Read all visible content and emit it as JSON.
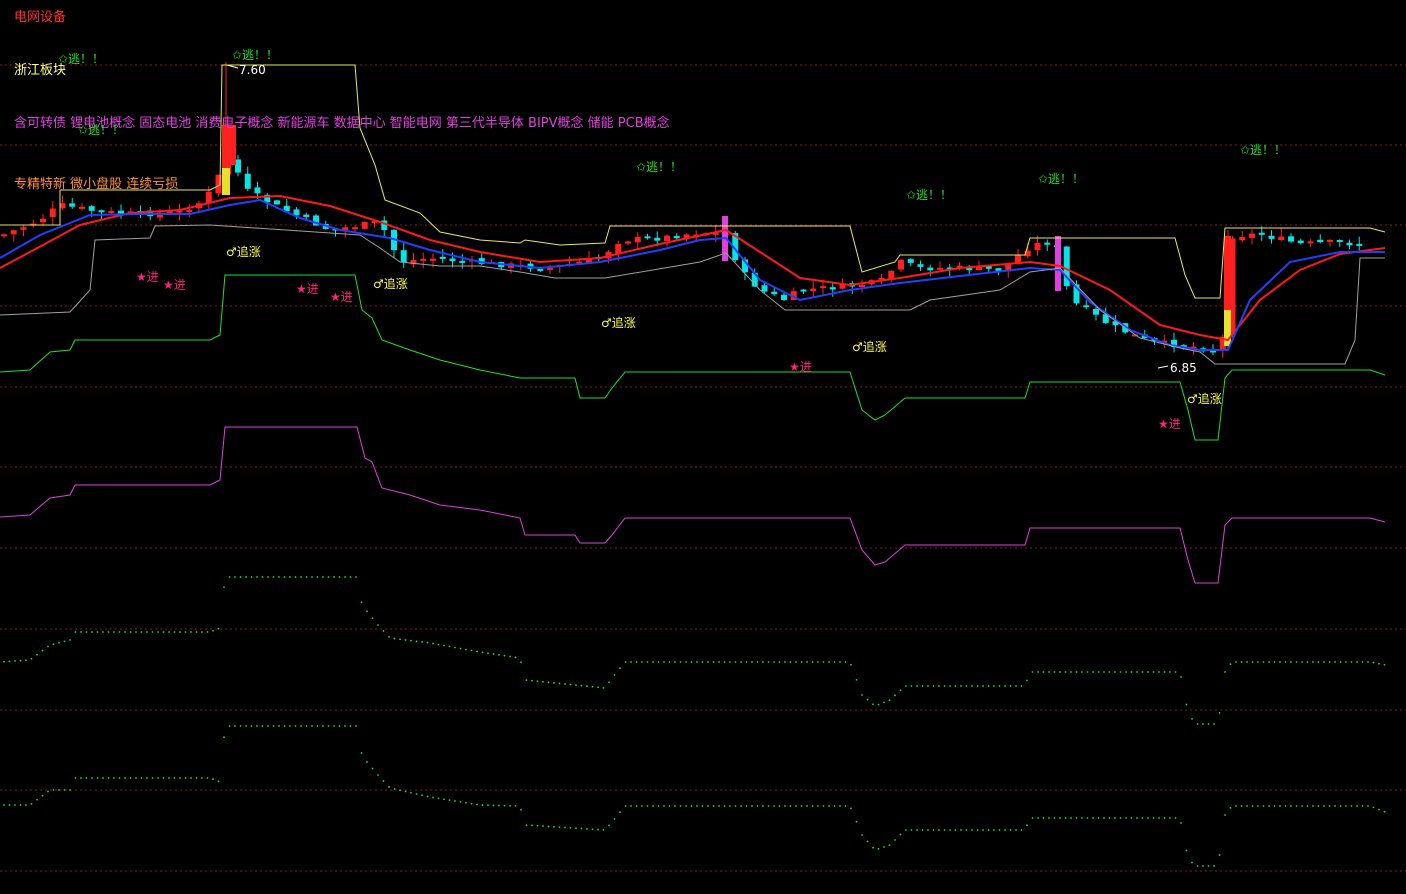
{
  "header": {
    "stock_sector": "电网设备",
    "region": "浙江板块",
    "concepts": "含可转债 锂电池概念 固态电池 消费电子概念 新能源车 数据中心 智能电网 第三代半导体 BIPV概念 储能 PCB概念",
    "tags": "专精特新 微小盘股 连续亏损"
  },
  "colors": {
    "background": "#000000",
    "grid": "#8b1a1a",
    "sector_text": "#ff3030",
    "region_text": "#ffff80",
    "concepts_text": "#e040e0",
    "tags_text": "#ff9030",
    "up_candle": "#ff2020",
    "down_candle": "#00e5e5",
    "ma_fast": "#2040ff",
    "ma_slow": "#ff1a1a",
    "band_yellow": "#e8e860",
    "band_gray": "#a0a0a0",
    "band_green": "#20e020",
    "band_magenta": "#e040e0",
    "dots": "#20e020",
    "escape_signal": "#20e020",
    "chase_signal": "#ffff40",
    "enter_signal": "#ff2080"
  },
  "chart_data": {
    "type": "candlestick",
    "bars": 140,
    "annotations": [
      {
        "text": "7.60",
        "bar": 22,
        "kind": "high"
      },
      {
        "text": "6.85",
        "bar": 115,
        "kind": "low"
      }
    ],
    "signals": [
      {
        "text": "✩逃！！",
        "kind": "escape",
        "bar": 6
      },
      {
        "text": "✩逃！！",
        "kind": "escape",
        "bar": 23
      },
      {
        "text": "✩逃！！",
        "kind": "escape",
        "bar": 8
      },
      {
        "text": "✩逃！！",
        "kind": "escape",
        "bar": 63
      },
      {
        "text": "✩逃！！",
        "kind": "escape",
        "bar": 90
      },
      {
        "text": "✩逃！！",
        "kind": "escape",
        "bar": 104
      },
      {
        "text": "✩逃！！",
        "kind": "escape",
        "bar": 124
      },
      {
        "text": "♂追涨",
        "kind": "chase",
        "bar": 22
      },
      {
        "text": "♂追涨",
        "kind": "chase",
        "bar": 37
      },
      {
        "text": "♂追涨",
        "kind": "chase",
        "bar": 60
      },
      {
        "text": "♂追涨",
        "kind": "chase",
        "bar": 85
      },
      {
        "text": "♂追涨",
        "kind": "chase",
        "bar": 118
      },
      {
        "text": "★进",
        "kind": "enter",
        "bar": 13
      },
      {
        "text": "★进",
        "kind": "enter",
        "bar": 16
      },
      {
        "text": "★进",
        "kind": "enter",
        "bar": 29
      },
      {
        "text": "★进",
        "kind": "enter",
        "bar": 33
      },
      {
        "text": "★进",
        "kind": "enter",
        "bar": 79
      },
      {
        "text": "★进",
        "kind": "enter",
        "bar": 116
      }
    ]
  }
}
